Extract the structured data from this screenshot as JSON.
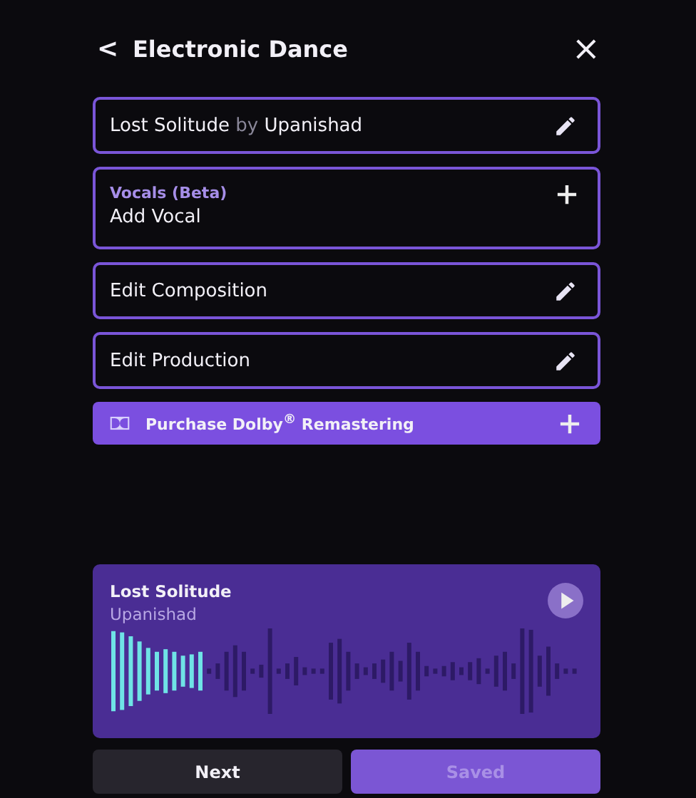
{
  "header": {
    "back": "<",
    "title": "Electronic Dance",
    "close": "×"
  },
  "rows": [
    {
      "kind": "track",
      "title": "Lost Solitude",
      "by": "by",
      "artist": "Upanishad"
    },
    {
      "kind": "add",
      "label": "Vocals (Beta)",
      "title": "Add Vocal"
    },
    {
      "kind": "edit",
      "title": "Edit Composition"
    },
    {
      "kind": "edit",
      "title": "Edit Production"
    }
  ],
  "dolby": {
    "label": "Purchase Dolby$^{®}$ Remastering"
  },
  "player": {
    "title": "Lost Solitude",
    "artist": "Upanishad"
  },
  "buttons": [
    {
      "label": "Next",
      "disabled": false,
      "kind": "secondary"
    },
    {
      "label": "Saved",
      "disabled": true,
      "kind": "primary"
    }
  ]
}
